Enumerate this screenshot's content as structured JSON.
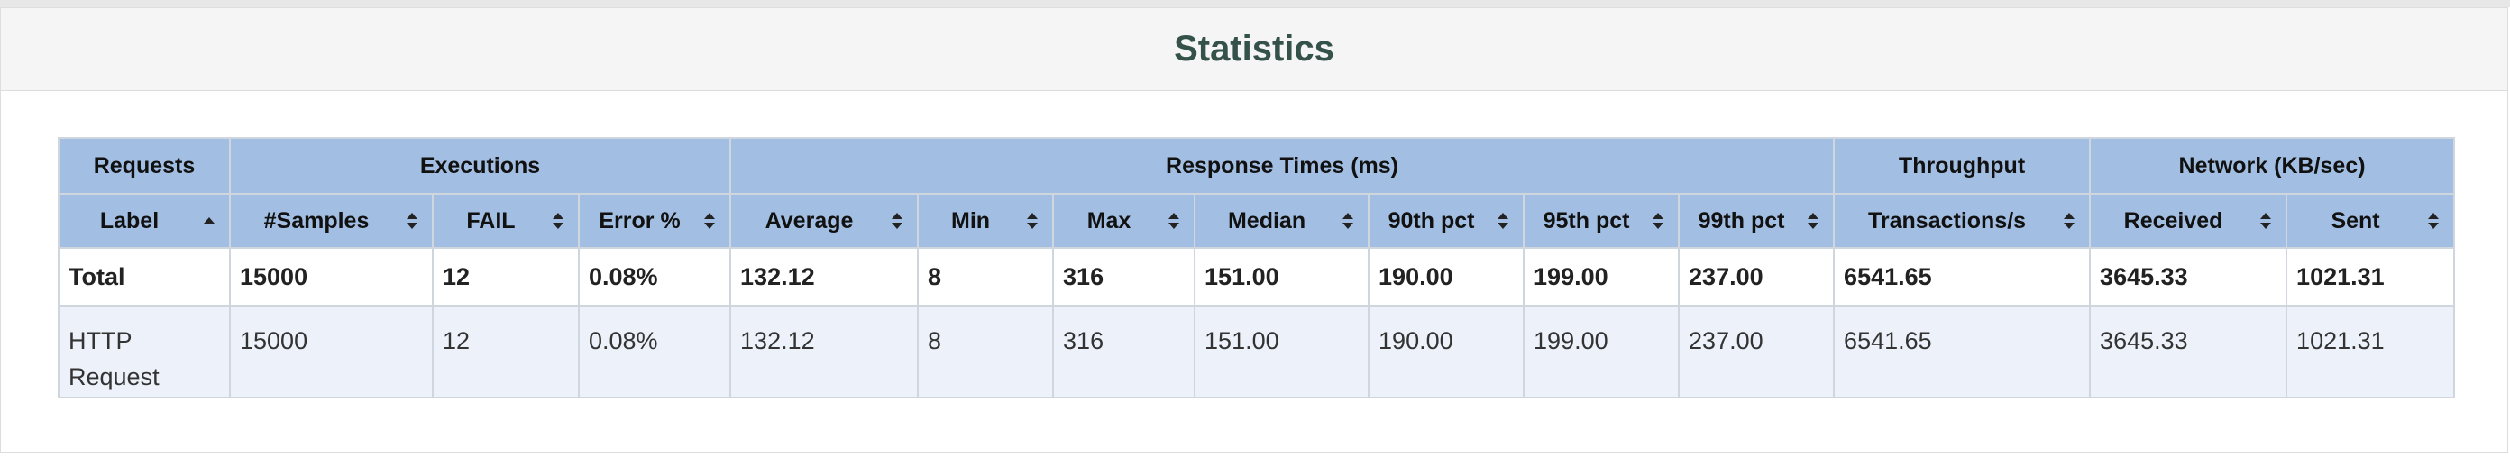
{
  "page": {
    "title": "Statistics"
  },
  "table": {
    "groups": [
      {
        "label": "Requests",
        "span": 1
      },
      {
        "label": "Executions",
        "span": 3
      },
      {
        "label": "Response Times (ms)",
        "span": 7
      },
      {
        "label": "Throughput",
        "span": 1
      },
      {
        "label": "Network (KB/sec)",
        "span": 2
      }
    ],
    "columns": [
      {
        "label": "Label",
        "sort": "asc"
      },
      {
        "label": "#Samples",
        "sort": "both"
      },
      {
        "label": "FAIL",
        "sort": "both"
      },
      {
        "label": "Error %",
        "sort": "both"
      },
      {
        "label": "Average",
        "sort": "both"
      },
      {
        "label": "Min",
        "sort": "both"
      },
      {
        "label": "Max",
        "sort": "both"
      },
      {
        "label": "Median",
        "sort": "both"
      },
      {
        "label": "90th pct",
        "sort": "both"
      },
      {
        "label": "95th pct",
        "sort": "both"
      },
      {
        "label": "99th pct",
        "sort": "both"
      },
      {
        "label": "Transactions/s",
        "sort": "both"
      },
      {
        "label": "Received",
        "sort": "both"
      },
      {
        "label": "Sent",
        "sort": "both"
      }
    ],
    "total": [
      "Total",
      "15000",
      "12",
      "0.08%",
      "132.12",
      "8",
      "316",
      "151.00",
      "190.00",
      "199.00",
      "237.00",
      "6541.65",
      "3645.33",
      "1021.31"
    ],
    "rows": [
      [
        "HTTP Request",
        "15000",
        "12",
        "0.08%",
        "132.12",
        "8",
        "316",
        "151.00",
        "190.00",
        "199.00",
        "237.00",
        "6541.65",
        "3645.33",
        "1021.31"
      ]
    ]
  }
}
